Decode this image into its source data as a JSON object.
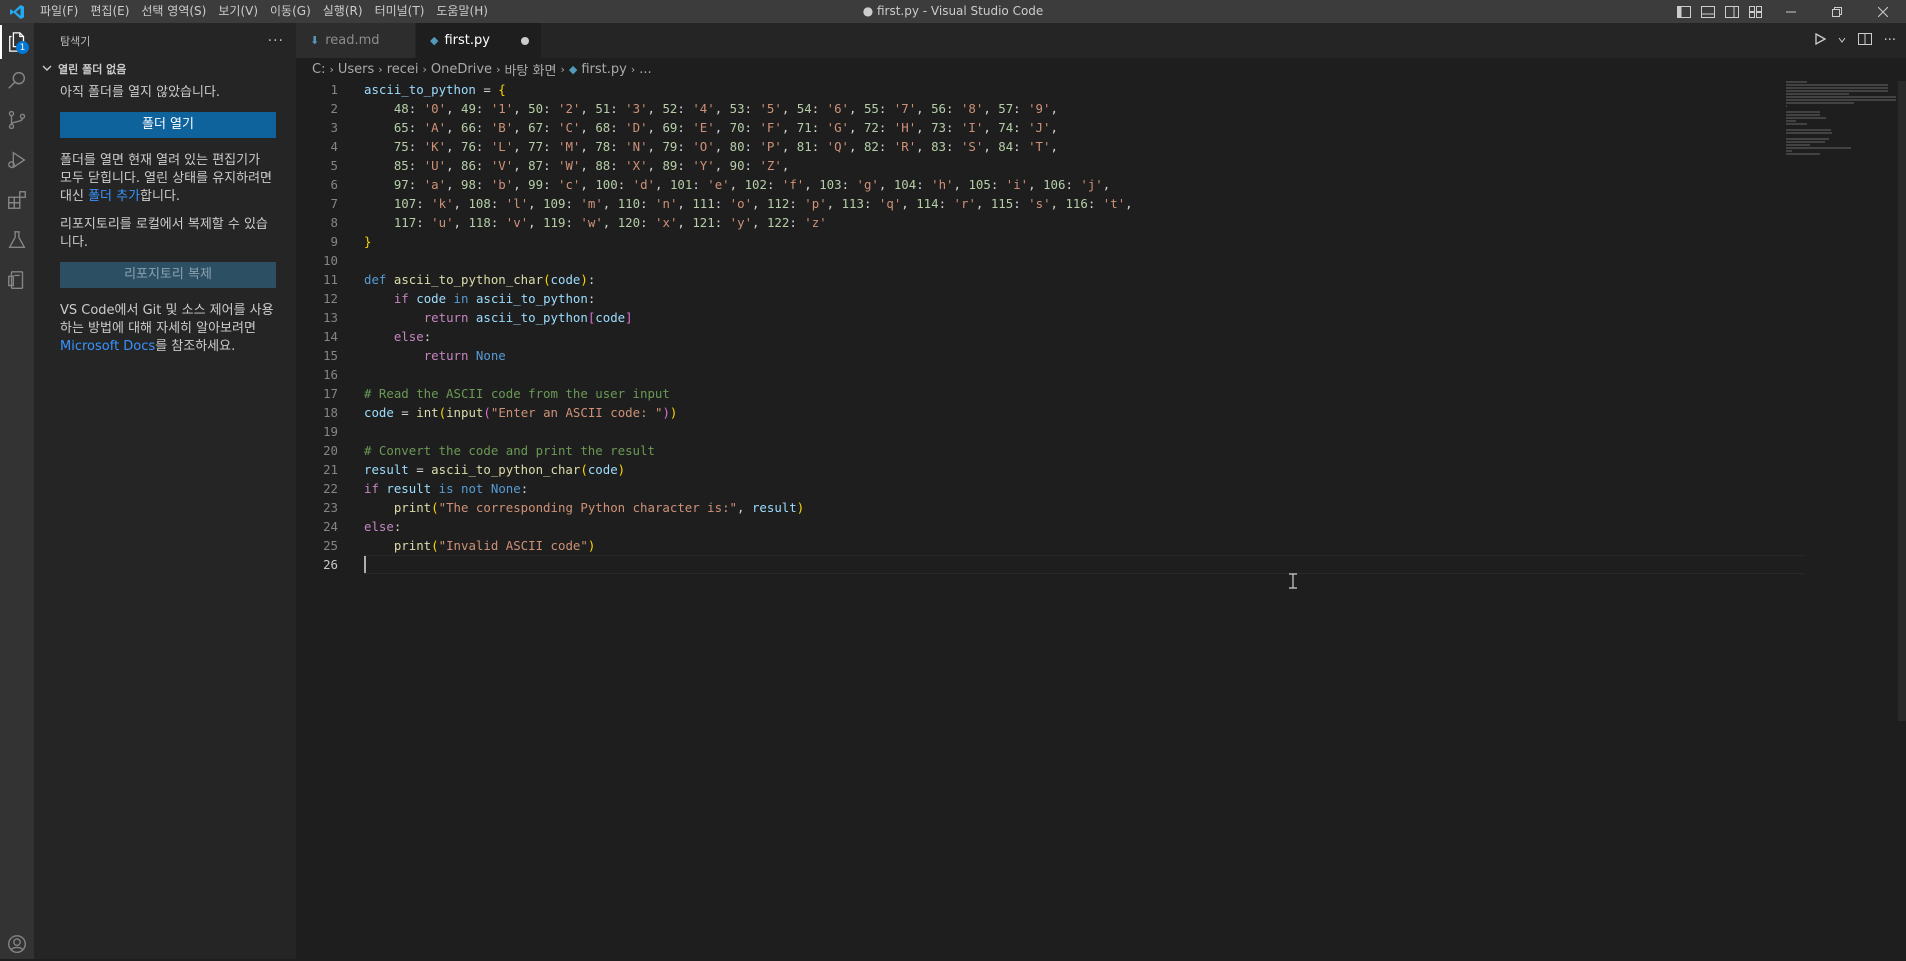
{
  "titlebar": {
    "menu": [
      "파일(F)",
      "편집(E)",
      "선택 영역(S)",
      "보기(V)",
      "이동(G)",
      "실행(R)",
      "터미널(T)",
      "도움말(H)"
    ],
    "title": "● first.py - Visual Studio Code"
  },
  "activity": {
    "explorer_badge": "1"
  },
  "sidebar": {
    "title": "탐색기",
    "more": "···",
    "section": "열린 폴더 없음",
    "no_folder_text": "아직 폴더를 열지 않았습니다.",
    "open_folder_button": "폴더 열기",
    "info1_a": "폴더를 열면 현재 열려 있는 편집기가 모두 닫힙니다. 열린 상태를 유지하려면 대신 ",
    "info1_link": "폴더 추가",
    "info1_b": "합니다.",
    "info2": "리포지토리를 로컬에서 복제할 수 있습니다.",
    "clone_button": "리포지토리 복제",
    "info3_a": "VS Code에서 Git 및 소스 제어를 사용하는 방법에 대해 자세히 알아보려면 ",
    "info3_link": "Microsoft Docs",
    "info3_b": "를 참조하세요."
  },
  "tabs": [
    {
      "label": "read.md",
      "active": false
    },
    {
      "label": "first.py",
      "active": true,
      "dirty": true
    }
  ],
  "breadcrumb": [
    "C:",
    "Users",
    "recei",
    "OneDrive",
    "바탕 화면",
    "first.py",
    "..."
  ],
  "editor": {
    "line_numbers": [
      "1",
      "2",
      "3",
      "4",
      "5",
      "6",
      "7",
      "8",
      "9",
      "10",
      "11",
      "12",
      "13",
      "14",
      "15",
      "16",
      "17",
      "18",
      "19",
      "20",
      "21",
      "22",
      "23",
      "24",
      "25",
      "26"
    ],
    "current_line": "26"
  },
  "colors": {
    "accent": "#0e639c",
    "link": "#3794ff",
    "titlebar": "#3c3c3c",
    "sidebar": "#252526",
    "editor": "#1e1e1e"
  }
}
